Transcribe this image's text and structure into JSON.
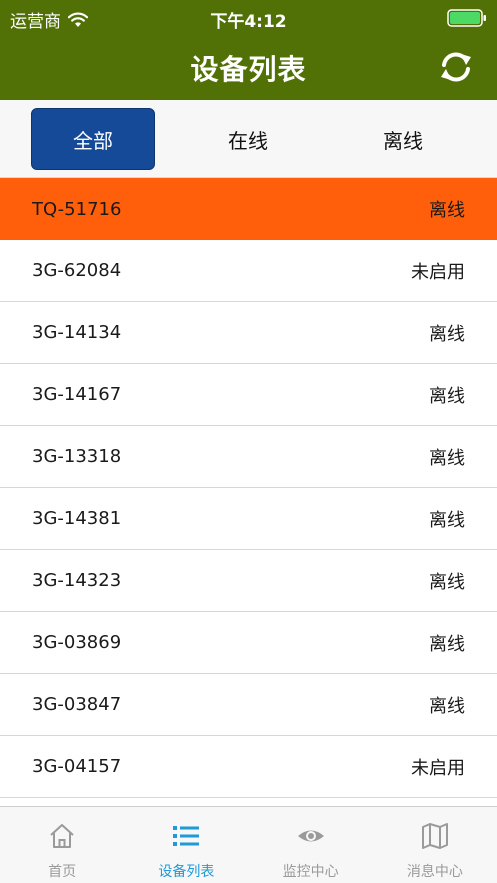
{
  "status_bar": {
    "carrier": "运营商",
    "time": "下午4:12"
  },
  "nav": {
    "title": "设备列表"
  },
  "segments": [
    {
      "label": "全部",
      "active": true
    },
    {
      "label": "在线",
      "active": false
    },
    {
      "label": "离线",
      "active": false
    }
  ],
  "devices": [
    {
      "id": "TQ-51716",
      "status": "离线",
      "highlighted": true
    },
    {
      "id": "3G-62084",
      "status": "未启用"
    },
    {
      "id": "3G-14134",
      "status": "离线"
    },
    {
      "id": "3G-14167",
      "status": "离线"
    },
    {
      "id": "3G-13318",
      "status": "离线"
    },
    {
      "id": "3G-14381",
      "status": "离线"
    },
    {
      "id": "3G-14323",
      "status": "离线"
    },
    {
      "id": "3G-03869",
      "status": "离线"
    },
    {
      "id": "3G-03847",
      "status": "离线"
    },
    {
      "id": "3G-04157",
      "status": "未启用"
    }
  ],
  "tabs": [
    {
      "label": "首页",
      "icon": "home-icon",
      "active": false
    },
    {
      "label": "设备列表",
      "icon": "list-icon",
      "active": true
    },
    {
      "label": "监控中心",
      "icon": "eye-icon",
      "active": false
    },
    {
      "label": "消息中心",
      "icon": "map-icon",
      "active": false
    }
  ],
  "colors": {
    "header": "#517006",
    "segment_active": "#154a98",
    "row_highlight": "#ff5f0a",
    "tab_active": "#1f9ad6",
    "tab_inactive": "#9a9a9a",
    "battery": "#4cd964"
  }
}
